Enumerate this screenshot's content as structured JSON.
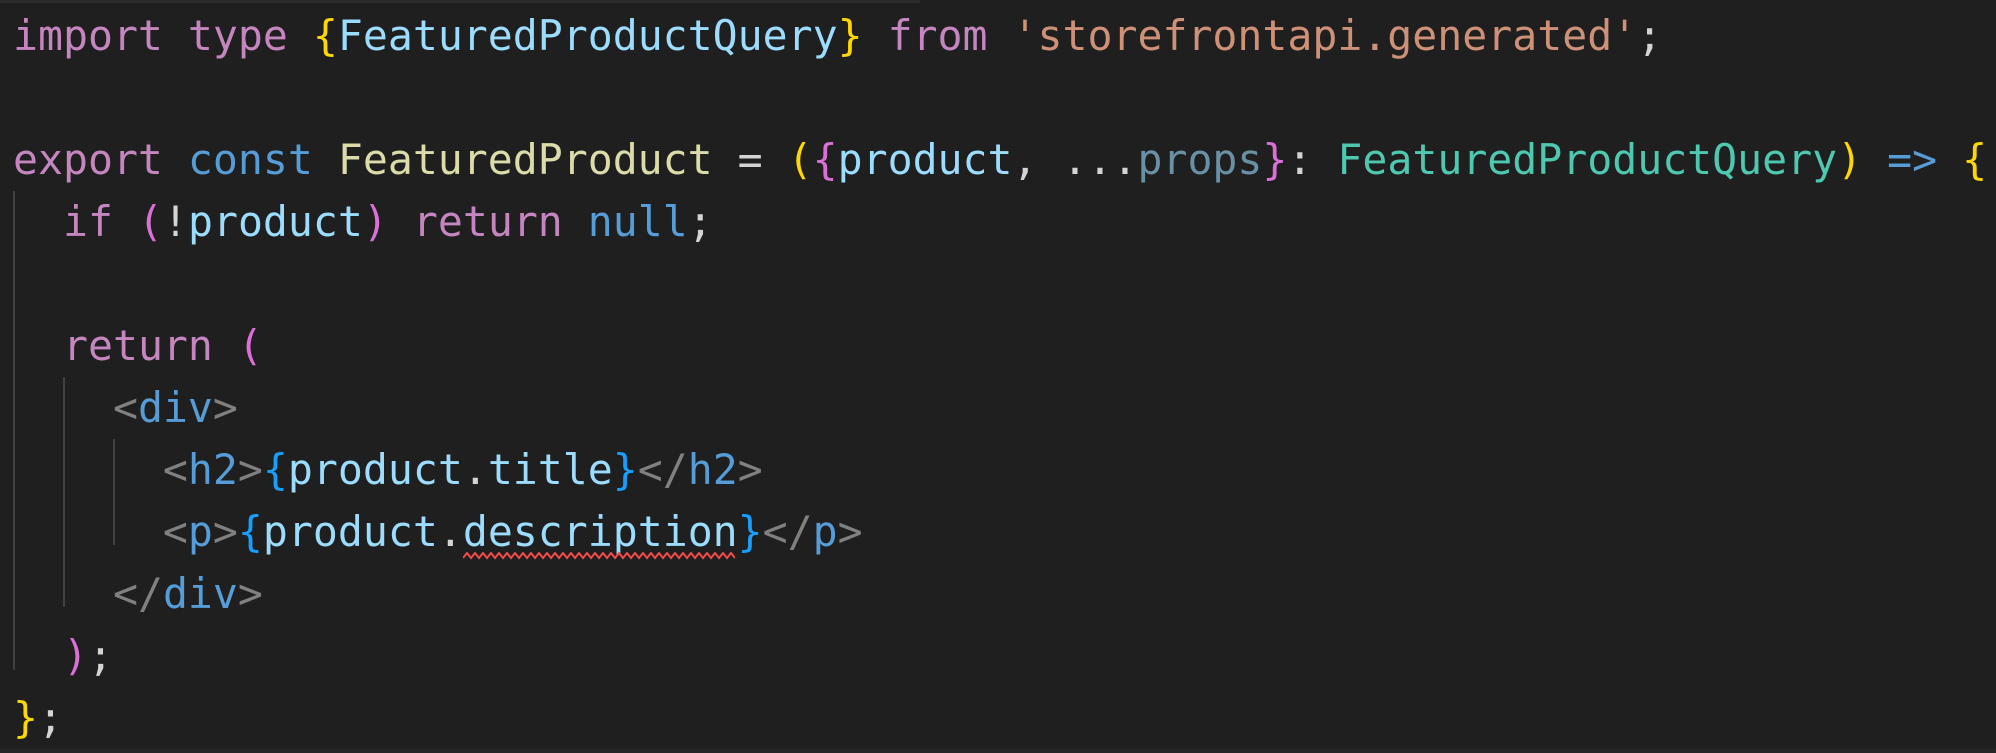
{
  "editor": {
    "lines": [
      [
        [
          "import",
          "kw"
        ],
        [
          " ",
          "pn"
        ],
        [
          "type",
          "kw"
        ],
        [
          " ",
          "pn"
        ],
        [
          "{",
          "b1"
        ],
        [
          "FeaturedProductQuery",
          "var"
        ],
        [
          "}",
          "b1"
        ],
        [
          " ",
          "pn"
        ],
        [
          "from",
          "kw"
        ],
        [
          " ",
          "pn"
        ],
        [
          "'storefrontapi.generated'",
          "str"
        ],
        [
          ";",
          "pn"
        ]
      ],
      [],
      [
        [
          "export",
          "kw"
        ],
        [
          " ",
          "pn"
        ],
        [
          "const",
          "st"
        ],
        [
          " ",
          "pn"
        ],
        [
          "FeaturedProduct",
          "fn"
        ],
        [
          " = ",
          "pn"
        ],
        [
          "(",
          "b1"
        ],
        [
          "{",
          "b2"
        ],
        [
          "product",
          "var"
        ],
        [
          ", ",
          "pn"
        ],
        [
          "...",
          "pn"
        ],
        [
          "props",
          "unused"
        ],
        [
          "}",
          "b2"
        ],
        [
          ": ",
          "pn"
        ],
        [
          "FeaturedProductQuery",
          "ty"
        ],
        [
          ")",
          "b1"
        ],
        [
          " ",
          "pn"
        ],
        [
          "=>",
          "st"
        ],
        [
          " ",
          "pn"
        ],
        [
          "{",
          "b1"
        ]
      ],
      [
        [
          "  ",
          "pn"
        ],
        [
          "if",
          "kw"
        ],
        [
          " ",
          "pn"
        ],
        [
          "(",
          "b2"
        ],
        [
          "!",
          "pn"
        ],
        [
          "product",
          "var"
        ],
        [
          ")",
          "b2"
        ],
        [
          " ",
          "pn"
        ],
        [
          "return",
          "kw"
        ],
        [
          " ",
          "pn"
        ],
        [
          "null",
          "st"
        ],
        [
          ";",
          "pn"
        ]
      ],
      [],
      [
        [
          "  ",
          "pn"
        ],
        [
          "return",
          "kw"
        ],
        [
          " ",
          "pn"
        ],
        [
          "(",
          "b2"
        ]
      ],
      [
        [
          "    ",
          "pn"
        ],
        [
          "<",
          "tag"
        ],
        [
          "div",
          "tagname"
        ],
        [
          ">",
          "tag"
        ]
      ],
      [
        [
          "      ",
          "pn"
        ],
        [
          "<",
          "tag"
        ],
        [
          "h2",
          "tagname"
        ],
        [
          ">",
          "tag"
        ],
        [
          "{",
          "b3"
        ],
        [
          "product",
          "var"
        ],
        [
          ".",
          "pn"
        ],
        [
          "title",
          "var"
        ],
        [
          "}",
          "b3"
        ],
        [
          "</",
          "tag"
        ],
        [
          "h2",
          "tagname"
        ],
        [
          ">",
          "tag"
        ]
      ],
      [
        [
          "      ",
          "pn"
        ],
        [
          "<",
          "tag"
        ],
        [
          "p",
          "tagname"
        ],
        [
          ">",
          "tag"
        ],
        [
          "{",
          "b3"
        ],
        [
          "product",
          "var"
        ],
        [
          ".",
          "pn"
        ],
        [
          "description",
          "var"
        ],
        [
          "}",
          "b3"
        ],
        [
          "</",
          "tag"
        ],
        [
          "p",
          "tagname"
        ],
        [
          ">",
          "tag"
        ]
      ],
      [
        [
          "    ",
          "pn"
        ],
        [
          "</",
          "tag"
        ],
        [
          "div",
          "tagname"
        ],
        [
          ">",
          "tag"
        ]
      ],
      [
        [
          "  ",
          "pn"
        ],
        [
          ")",
          "b2"
        ],
        [
          ";",
          "pn"
        ]
      ],
      [
        [
          "}",
          "b1"
        ],
        [
          ";",
          "pn"
        ]
      ]
    ],
    "error_squiggle_color": "#f14c4c"
  }
}
